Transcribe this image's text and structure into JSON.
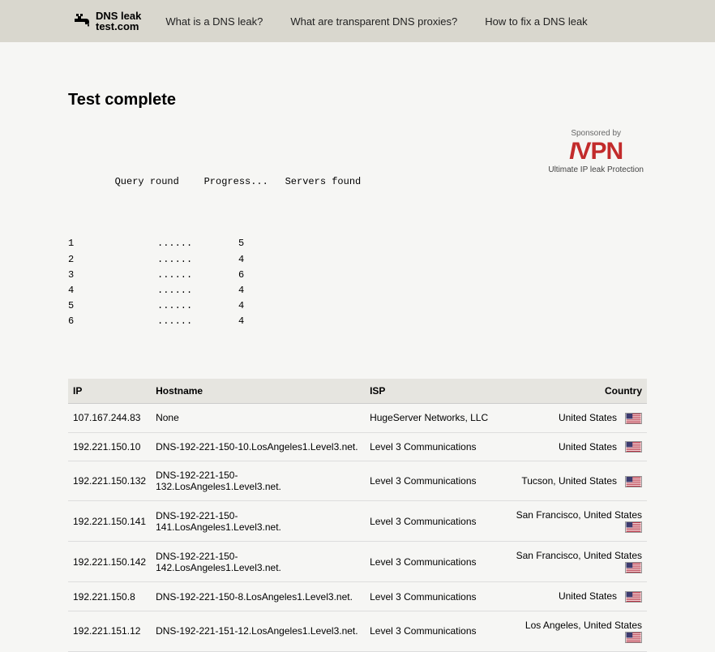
{
  "logo": {
    "line1": "DNS leak",
    "line2": "test.com"
  },
  "nav": {
    "items": [
      {
        "label": "What is a DNS leak?"
      },
      {
        "label": "What are transparent DNS proxies?"
      },
      {
        "label": "How to fix a DNS leak"
      }
    ]
  },
  "title": "Test complete",
  "progress": {
    "headers": {
      "qr": "Query round",
      "pr": "Progress...",
      "sf": "Servers found"
    },
    "rows": [
      {
        "round": "1",
        "dots": "......",
        "found": "5"
      },
      {
        "round": "2",
        "dots": "......",
        "found": "4"
      },
      {
        "round": "3",
        "dots": "......",
        "found": "6"
      },
      {
        "round": "4",
        "dots": "......",
        "found": "4"
      },
      {
        "round": "5",
        "dots": "......",
        "found": "4"
      },
      {
        "round": "6",
        "dots": "......",
        "found": "4"
      }
    ]
  },
  "sponsor": {
    "label": "Sponsored by",
    "brand": "IVPN",
    "tag": "Ultimate IP leak Protection"
  },
  "table": {
    "headers": {
      "ip": "IP",
      "host": "Hostname",
      "isp": "ISP",
      "country": "Country"
    },
    "rows": [
      {
        "ip": "107.167.244.83",
        "host": "None",
        "isp": "HugeServer Networks, LLC",
        "country": "United States",
        "flag": "us"
      },
      {
        "ip": "192.221.150.10",
        "host": "DNS-192-221-150-10.LosAngeles1.Level3.net.",
        "isp": "Level 3 Communications",
        "country": "United States",
        "flag": "us"
      },
      {
        "ip": "192.221.150.132",
        "host": "DNS-192-221-150-132.LosAngeles1.Level3.net.",
        "isp": "Level 3 Communications",
        "country": "Tucson, United States",
        "flag": "us"
      },
      {
        "ip": "192.221.150.141",
        "host": "DNS-192-221-150-141.LosAngeles1.Level3.net.",
        "isp": "Level 3 Communications",
        "country": "San Francisco, United States",
        "flag": "us"
      },
      {
        "ip": "192.221.150.142",
        "host": "DNS-192-221-150-142.LosAngeles1.Level3.net.",
        "isp": "Level 3 Communications",
        "country": "San Francisco, United States",
        "flag": "us"
      },
      {
        "ip": "192.221.150.8",
        "host": "DNS-192-221-150-8.LosAngeles1.Level3.net.",
        "isp": "Level 3 Communications",
        "country": "United States",
        "flag": "us"
      },
      {
        "ip": "192.221.151.12",
        "host": "DNS-192-221-151-12.LosAngeles1.Level3.net.",
        "isp": "Level 3 Communications",
        "country": "Los Angeles, United States",
        "flag": "us"
      }
    ]
  }
}
